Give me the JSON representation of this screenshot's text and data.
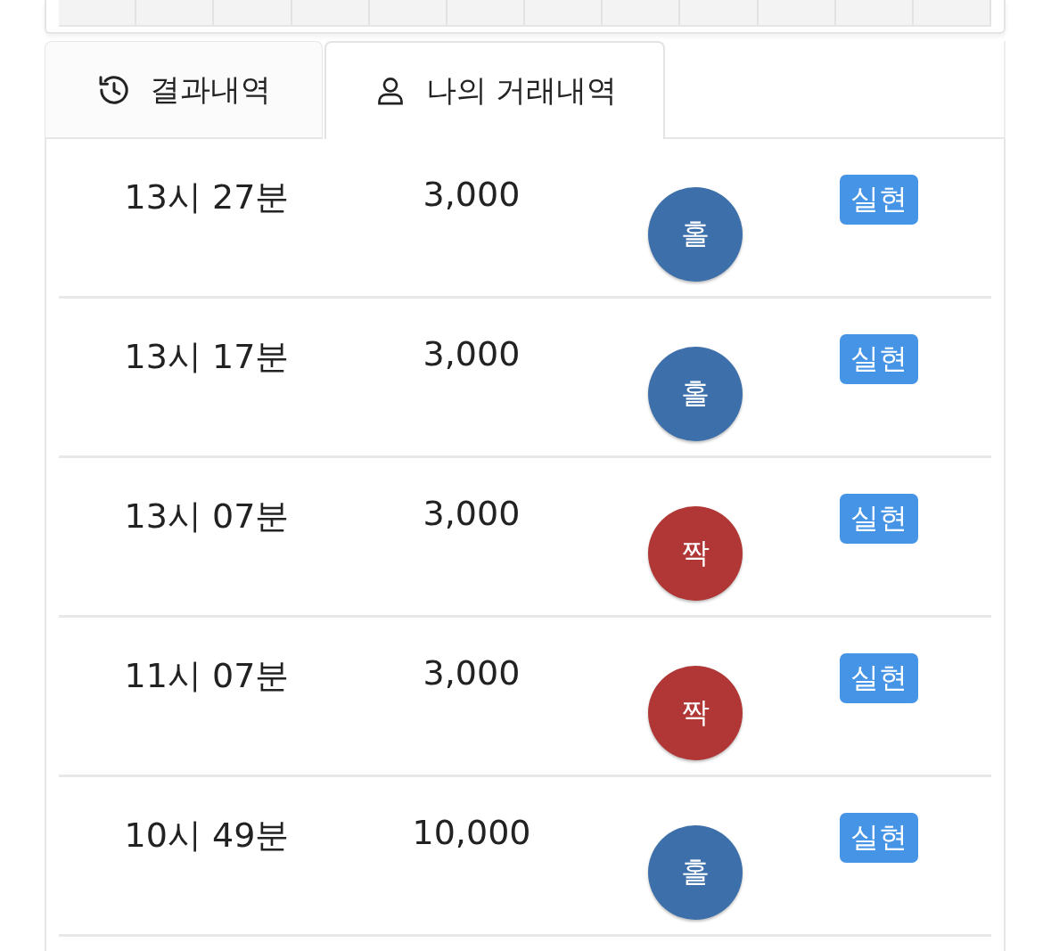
{
  "top_grid": {
    "kind": "grid"
  },
  "tabs": [
    {
      "label": "결과내역",
      "kind": "history",
      "selected": false
    },
    {
      "label": "나의 거래내역",
      "kind": "person",
      "selected": true
    }
  ],
  "rows": [
    {
      "time": "13시 27분",
      "amount": "3,000",
      "result": "홀",
      "kind": "odd",
      "status": "실현"
    },
    {
      "time": "13시 17분",
      "amount": "3,000",
      "result": "홀",
      "kind": "odd",
      "status": "실현"
    },
    {
      "time": "13시 07분",
      "amount": "3,000",
      "result": "짝",
      "kind": "even",
      "status": "실현"
    },
    {
      "time": "11시 07분",
      "amount": "3,000",
      "result": "짝",
      "kind": "even",
      "status": "실현"
    },
    {
      "time": "10시 49분",
      "amount": "10,000",
      "result": "홀",
      "kind": "odd",
      "status": "실현"
    }
  ]
}
